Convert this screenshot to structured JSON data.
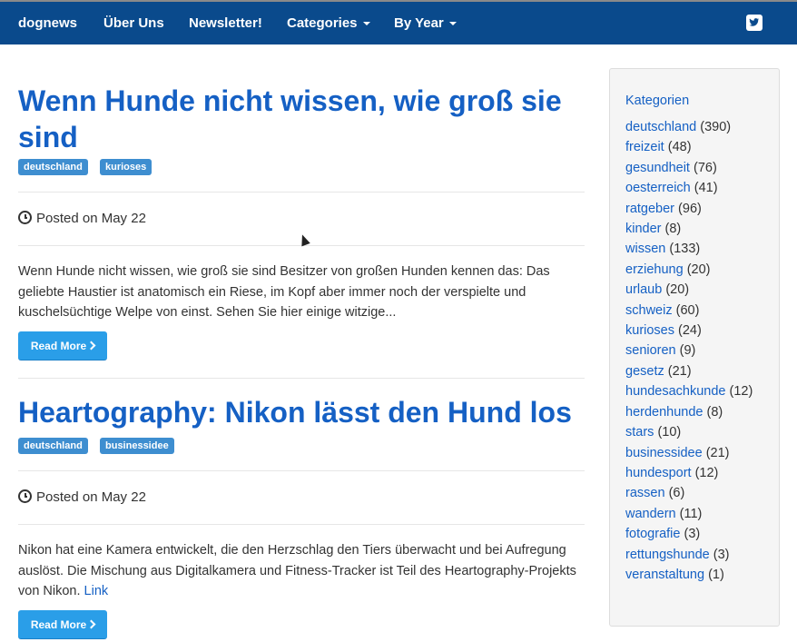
{
  "nav": {
    "brand": "dognews",
    "items": [
      "Über Uns",
      "Newsletter!",
      "Categories",
      "By Year"
    ]
  },
  "posts": [
    {
      "title": "Wenn Hunde nicht wissen, wie groß sie sind",
      "tags": [
        "deutschland",
        "kurioses"
      ],
      "posted": "Posted on May 22",
      "excerpt": "Wenn Hunde nicht wissen, wie groß sie sind Besitzer von großen Hunden kennen das: Das geliebte Haustier ist anatomisch ein Riese, im Kopf aber immer noch der verspielte und kuschelsüchtige Welpe von einst. Sehen Sie hier einige witzige...",
      "read_more": "Read More"
    },
    {
      "title": "Heartography: Nikon lässt den Hund los",
      "tags": [
        "deutschland",
        "businessidee"
      ],
      "posted": "Posted on May 22",
      "excerpt": "Nikon hat eine Kamera entwickelt, die den Herzschlag den Tiers überwacht und bei Aufregung auslöst. Die Mischung aus Digitalkamera und Fitness-Tracker ist Teil des Heartography-Projekts von Nikon.",
      "link": "Link",
      "read_more": "Read More"
    }
  ],
  "sidebar": {
    "title": "Kategorien",
    "categories": [
      {
        "name": "deutschland",
        "count": "(390)"
      },
      {
        "name": "freizeit",
        "count": "(48)"
      },
      {
        "name": "gesundheit",
        "count": "(76)"
      },
      {
        "name": "oesterreich",
        "count": "(41)"
      },
      {
        "name": "ratgeber",
        "count": "(96)"
      },
      {
        "name": "kinder",
        "count": "(8)"
      },
      {
        "name": "wissen",
        "count": "(133)"
      },
      {
        "name": "erziehung",
        "count": "(20)"
      },
      {
        "name": "urlaub",
        "count": "(20)"
      },
      {
        "name": "schweiz",
        "count": "(60)"
      },
      {
        "name": "kurioses",
        "count": "(24)"
      },
      {
        "name": "senioren",
        "count": "(9)"
      },
      {
        "name": "gesetz",
        "count": "(21)"
      },
      {
        "name": "hundesachkunde",
        "count": "(12)"
      },
      {
        "name": "herdenhunde",
        "count": "(8)"
      },
      {
        "name": "stars",
        "count": "(10)"
      },
      {
        "name": "businessidee",
        "count": "(21)"
      },
      {
        "name": "hundesport",
        "count": "(12)"
      },
      {
        "name": "rassen",
        "count": "(6)"
      },
      {
        "name": "wandern",
        "count": "(11)"
      },
      {
        "name": "fotografie",
        "count": "(3)"
      },
      {
        "name": "rettungshunde",
        "count": "(3)"
      },
      {
        "name": "veranstaltung",
        "count": "(1)"
      }
    ]
  },
  "icons": {
    "twitter": "twitter-icon",
    "clock": "clock-icon",
    "chevron": "chevron-right-icon"
  }
}
